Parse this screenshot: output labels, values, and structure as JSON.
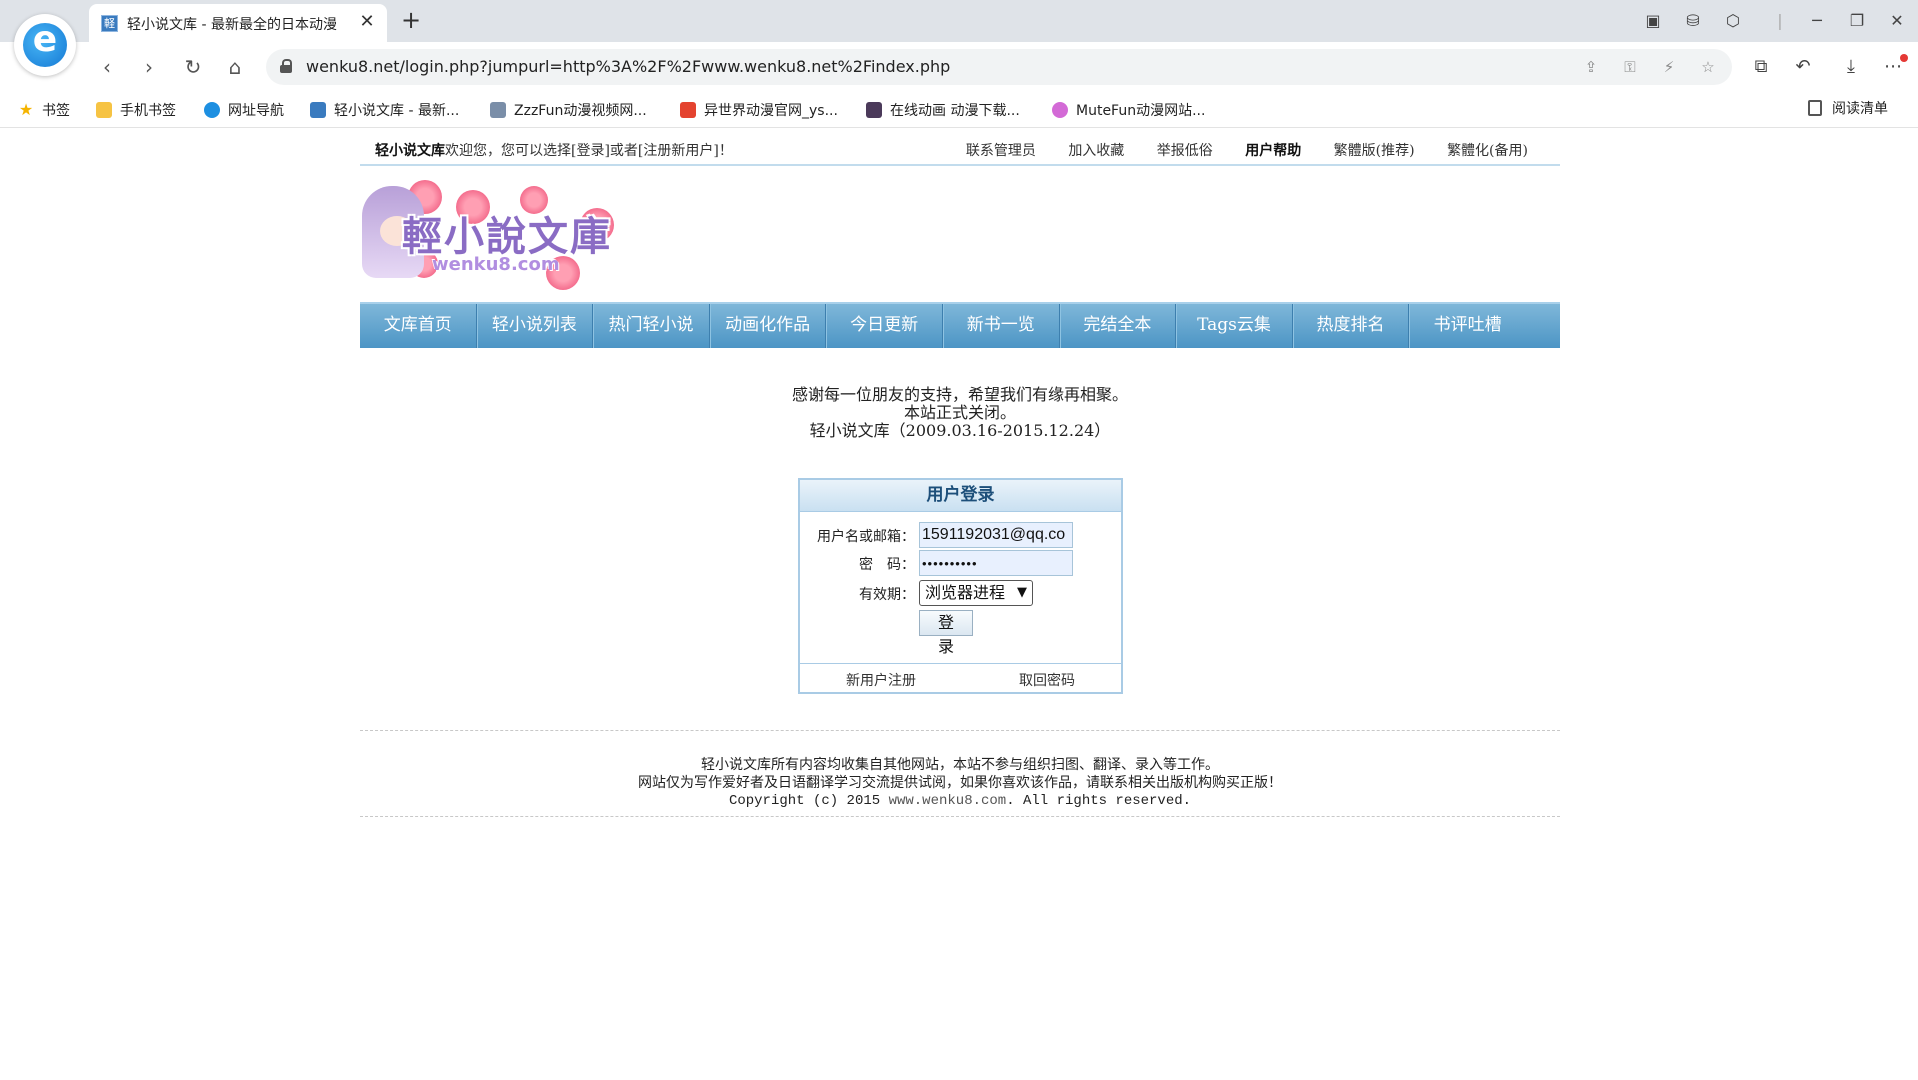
{
  "browser": {
    "tab_title": "轻小说文库 - 最新最全的日本动漫",
    "url": "wenku8.net/login.php?jumpurl=http%3A%2F%2Fwww.wenku8.net%2Findex.php",
    "bookmarks": [
      {
        "label": "书签",
        "icon": "star-icon"
      },
      {
        "label": "手机书签",
        "icon": "phone-bookmark-icon"
      },
      {
        "label": "网址导航",
        "icon": "nav-site-icon"
      },
      {
        "label": "轻小说文库 - 最新...",
        "icon": "wenku-favicon"
      },
      {
        "label": "ZzzFun动漫视频网...",
        "icon": "zzzfun-favicon"
      },
      {
        "label": "异世界动漫官网_ys...",
        "icon": "ysj-favicon"
      },
      {
        "label": "在线动画 动漫下载...",
        "icon": "anime-favicon"
      },
      {
        "label": "MuteFun动漫网站...",
        "icon": "mutefun-favicon"
      }
    ],
    "reading_list": "阅读清单"
  },
  "site": {
    "topbar": {
      "site_name": "轻小说文库",
      "welcome_text": "欢迎您，您可以选择[登录]或者[注册新用户]！",
      "links": [
        "联系管理员",
        "加入收藏",
        "举报低俗",
        "用户帮助",
        "繁體版(推荐)",
        "繁體化(备用)"
      ]
    },
    "logo": {
      "title": "輕小說文庫",
      "sub": "wenku8.com"
    },
    "nav": [
      "文库首页",
      "轻小说列表",
      "热门轻小说",
      "动画化作品",
      "今日更新",
      "新书一览",
      "完结全本",
      "Tags云集",
      "热度排名",
      "书评吐槽"
    ],
    "notice": [
      "感谢每一位朋友的支持，希望我们有缘再相聚。",
      "本站正式关闭。",
      "轻小说文库（2009.03.16-2015.12.24）"
    ]
  },
  "login": {
    "title": "用户登录",
    "username_label": "用户名或邮箱：",
    "username_value": "1591192031@qq.co",
    "password_label": "密　码：",
    "password_value": "••••••••••",
    "expiry_label": "有效期：",
    "expiry_value": "浏览器进程",
    "submit": "登 录",
    "register_link": "新用户注册",
    "recover_link": "取回密码"
  },
  "footer": {
    "line1": "轻小说文库所有内容均收集自其他网站，本站不参与组织扫图、翻译、录入等工作。",
    "line2": "网站仅为写作爱好者及日语翻译学习交流提供试阅，如果你喜欢该作品，请联系相关出版机构购买正版！",
    "copyright_prefix": "Copyright (c) 2015 ",
    "copyright_site": "www.wenku8.com",
    "copyright_suffix": ". All rights reserved."
  }
}
